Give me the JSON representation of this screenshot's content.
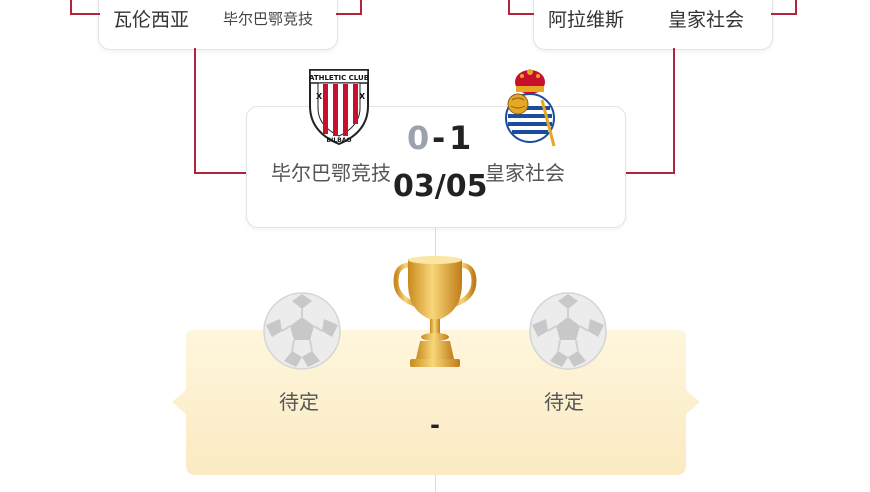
{
  "top_left": {
    "team_a": "瓦伦西亚",
    "team_b": "毕尔巴鄂竞技"
  },
  "top_right": {
    "team_a": "阿拉维斯",
    "team_b": "皇家社会"
  },
  "semi": {
    "home_team": "毕尔巴鄂竞技",
    "away_team": "皇家社会",
    "home_score": "0",
    "separator": "-",
    "away_score": "1",
    "date": "03/05",
    "home_crest_text": "ATHLETIC CLUB",
    "home_crest_bottom": "BILBAO"
  },
  "final": {
    "home_team": "待定",
    "away_team": "待定",
    "score": "-"
  },
  "colors": {
    "bracket": "#b3243a",
    "final_bg": "#fdf1cf",
    "trophy": "#e6a93a"
  }
}
